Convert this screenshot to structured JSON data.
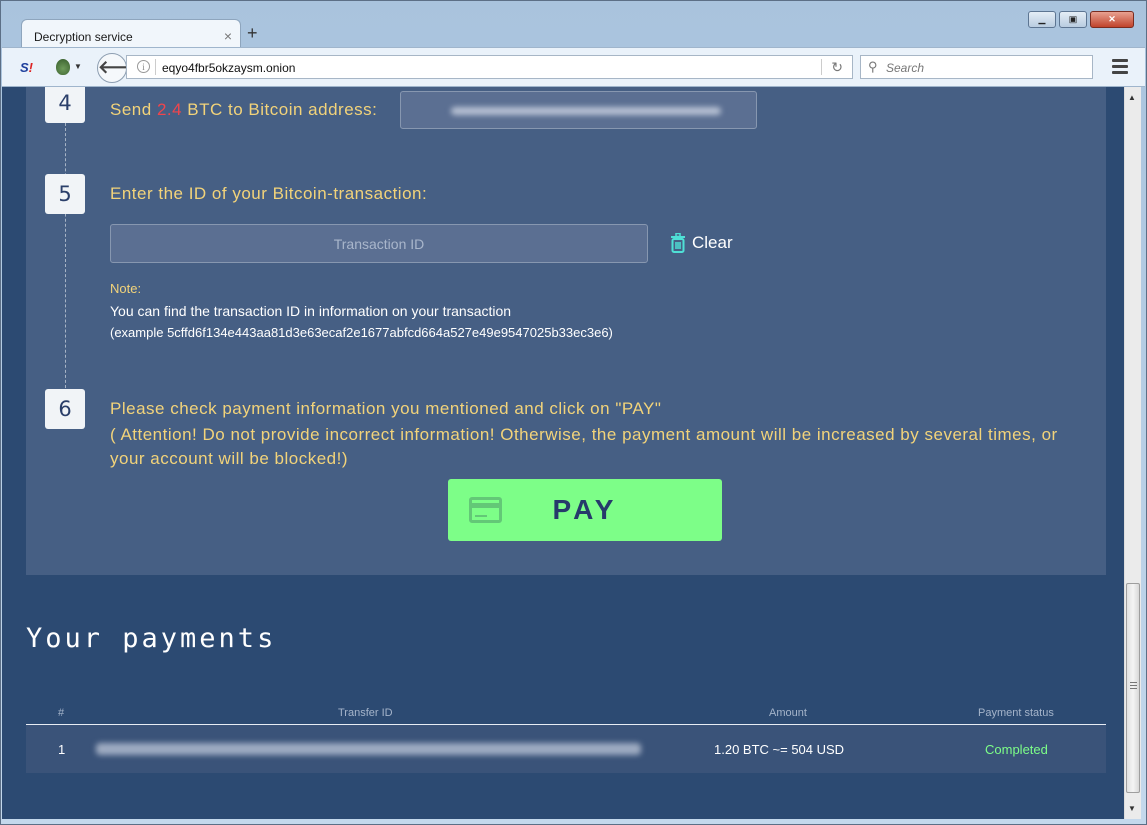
{
  "browser": {
    "tab_title": "Decryption service",
    "tab_close": "×",
    "new_tab": "+",
    "url": "eqyo4fbr5okzaysm.onion",
    "search_placeholder": "Search",
    "window_controls": {
      "minimize": "▁",
      "maximize": "▣",
      "close": "✕"
    }
  },
  "steps": [
    {
      "number": "4",
      "text_prefix": "Send ",
      "amount": "2.4",
      "text_suffix": " BTC to Bitcoin address:"
    },
    {
      "number": "5",
      "text": "Enter the ID of your Bitcoin-transaction:"
    },
    {
      "number": "6",
      "text": "Please check payment information you mentioned and click on \"PAY\"",
      "warning": "( Attention! Do not provide incorrect information! Otherwise, the payment amount will be increased by several times, or your account will be blocked!)"
    }
  ],
  "transaction_input": {
    "placeholder": "Transaction ID",
    "value": ""
  },
  "clear_label": "Clear",
  "note": {
    "label": "Note:",
    "text": "You can find the transaction ID in information on your transaction",
    "example": "(example 5cffd6f134e443aa81d3e63ecaf2e1677abfcd664a527e49e9547025b33ec3e6)"
  },
  "pay_label": "PAY",
  "payments": {
    "title": "Your payments",
    "columns": [
      "#",
      "Transfer ID",
      "Amount",
      "Payment status"
    ],
    "rows": [
      {
        "index": "1",
        "transfer_id": "[blurred]",
        "amount": "1.20 BTC ~= 504 USD",
        "status": "Completed"
      }
    ]
  },
  "colors": {
    "accent_yellow": "#f2d37a",
    "amount_red": "#f0454c",
    "pay_green": "#7dfe88",
    "panel_bg": "#465f84",
    "page_bg": "#2c4a72"
  }
}
